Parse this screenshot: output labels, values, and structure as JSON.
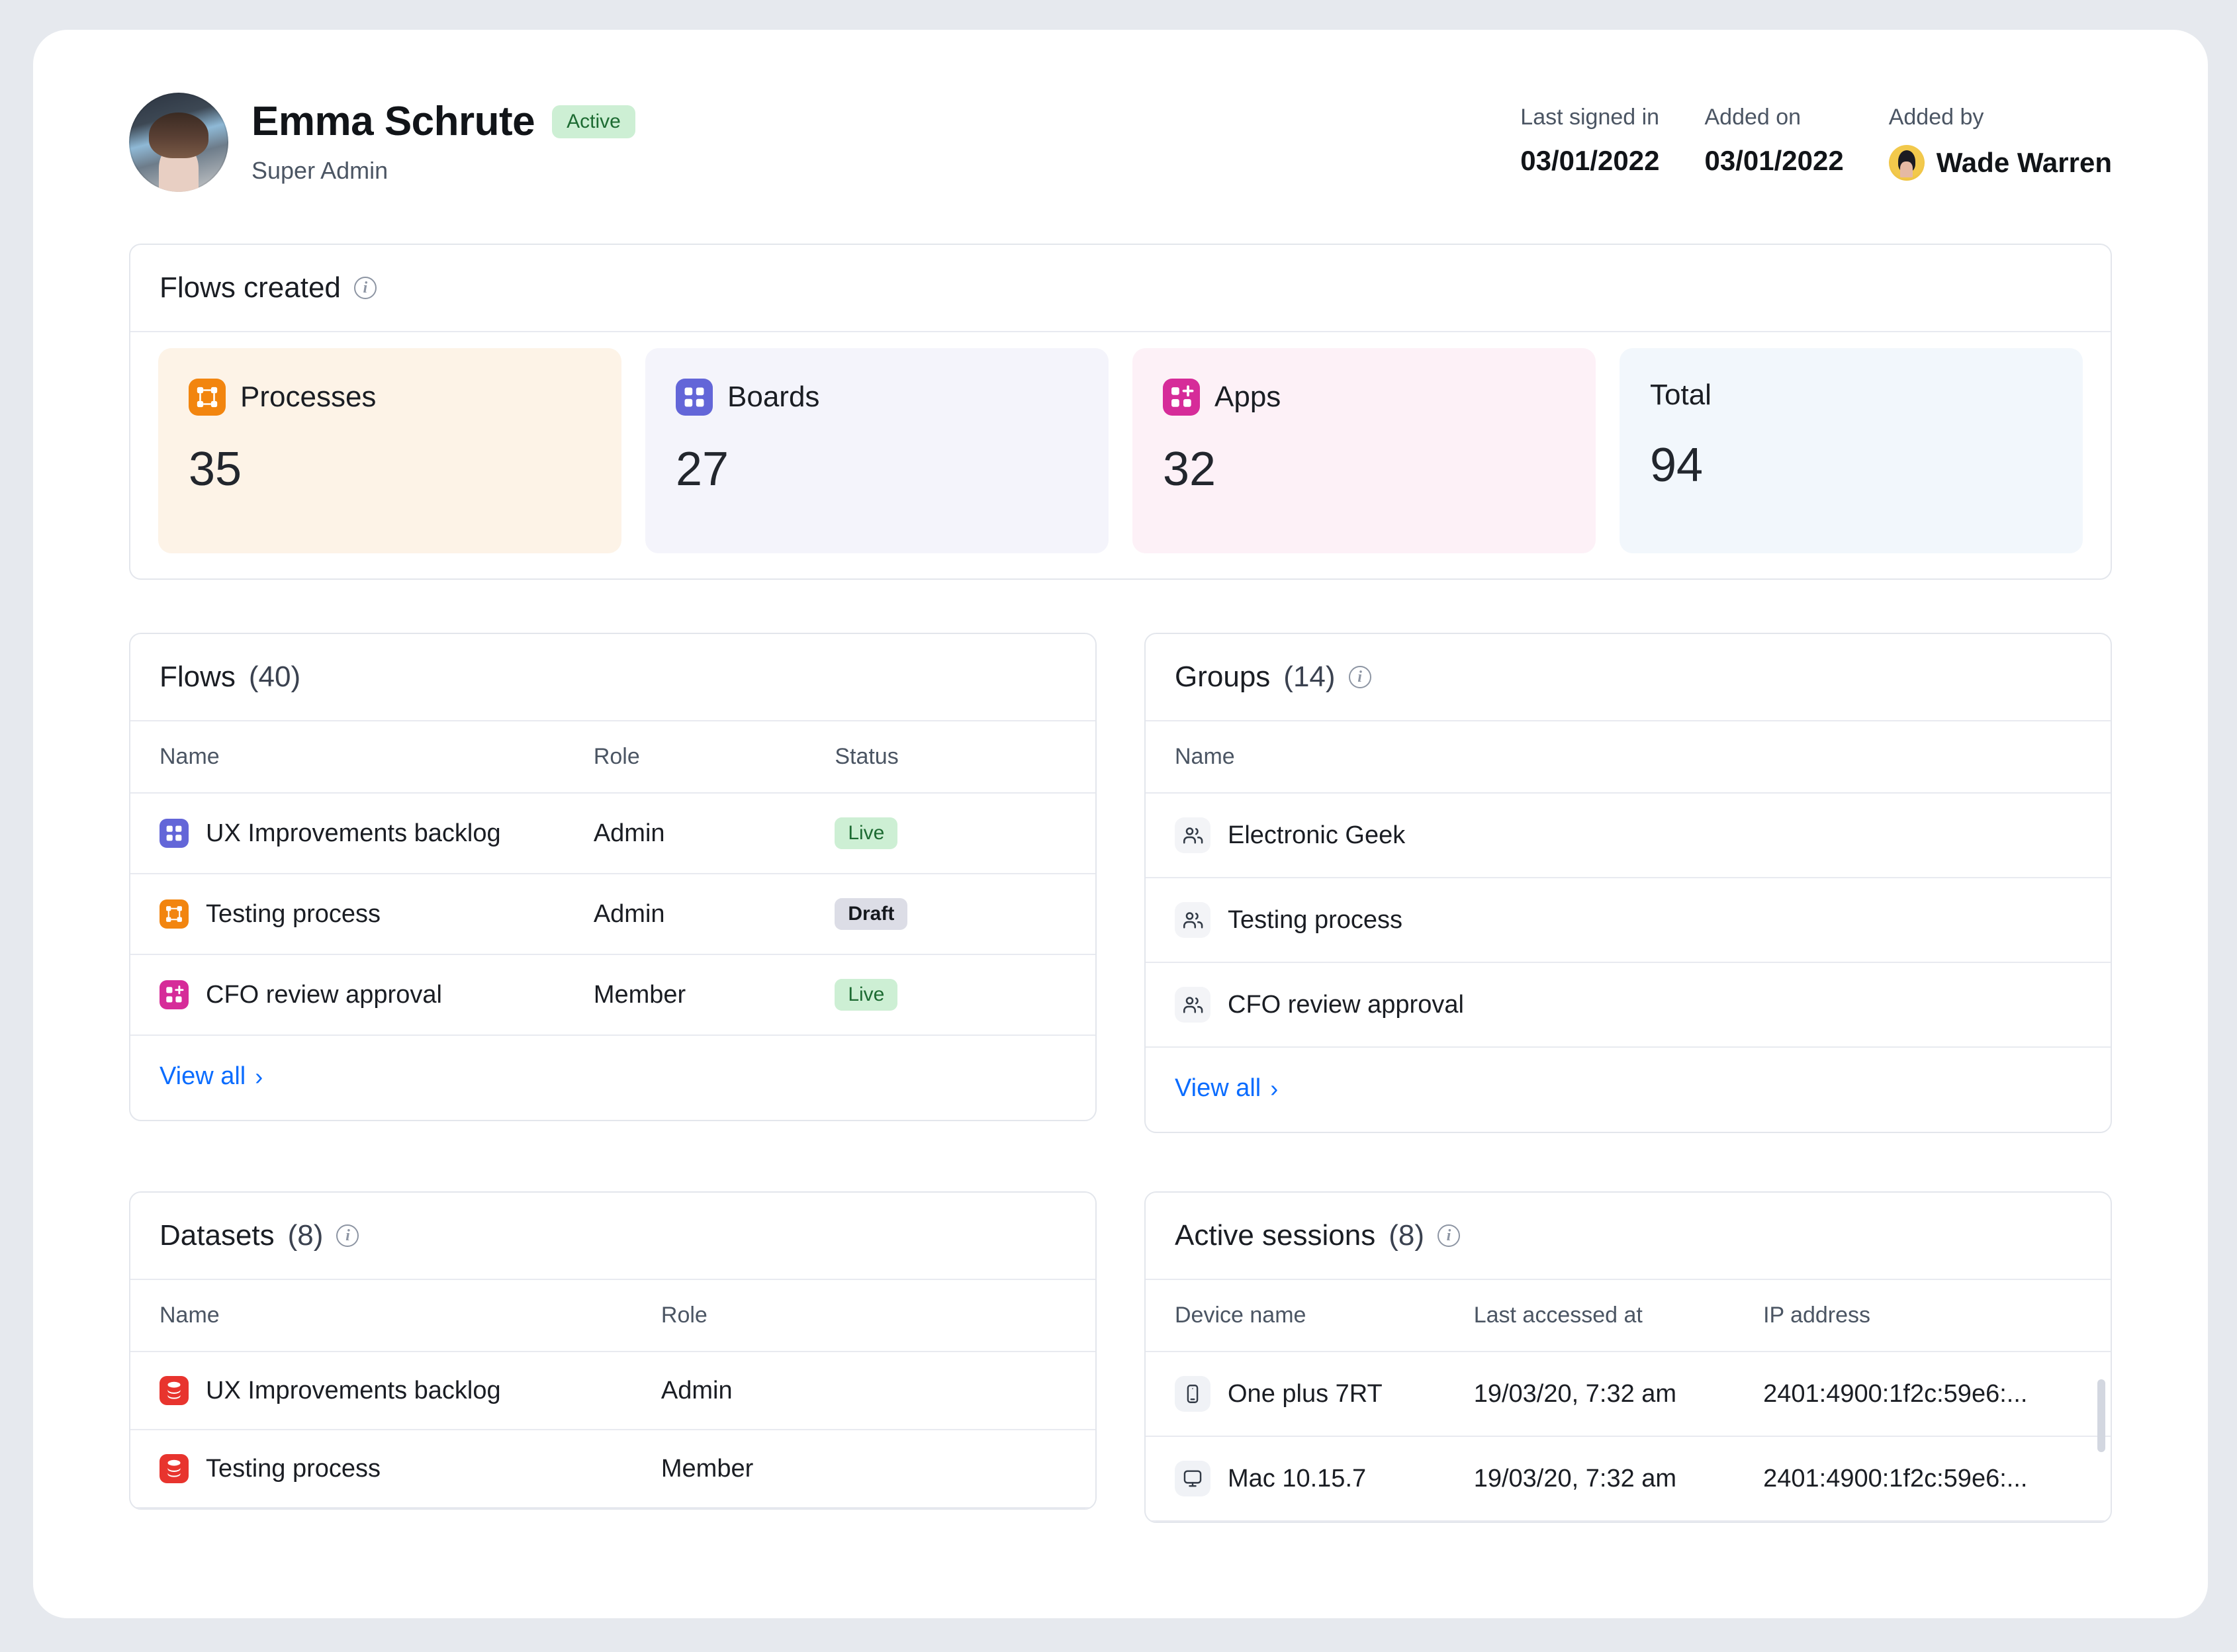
{
  "profile": {
    "name": "Emma Schrute",
    "status": "Active",
    "role": "Super Admin",
    "avatar_name": "emma-schrute-avatar",
    "meta": [
      {
        "label": "Last signed in",
        "value": "03/01/2022"
      },
      {
        "label": "Added on",
        "value": "03/01/2022"
      }
    ],
    "added_by_label": "Added by",
    "added_by_name": "Wade Warren"
  },
  "flows_created": {
    "title": "Flows created",
    "info_icon": "info-icon",
    "cards": [
      {
        "label": "Processes",
        "value": "35",
        "icon": "process-icon",
        "color": "#f2850f",
        "bg": "#fdf3e7"
      },
      {
        "label": "Boards",
        "value": "27",
        "icon": "board-icon",
        "color": "#6366d8",
        "bg": "#f4f4fb"
      },
      {
        "label": "Apps",
        "value": "32",
        "icon": "app-icon",
        "color": "#d62c99",
        "bg": "#fdf1f7"
      },
      {
        "label": "Total",
        "value": "94",
        "icon": "none",
        "color": "#22262d",
        "bg": "#f2f7fc"
      }
    ]
  },
  "flows": {
    "title": "Flows",
    "count": "(40)",
    "columns": [
      "Name",
      "Role",
      "Status"
    ],
    "rows": [
      {
        "icon": "board-icon",
        "name": "UX Improvements backlog",
        "role": "Admin",
        "status": "Live",
        "status_kind": "live"
      },
      {
        "icon": "process-icon",
        "name": "Testing process",
        "role": "Admin",
        "status": "Draft",
        "status_kind": "draft"
      },
      {
        "icon": "app-icon",
        "name": "CFO review approval",
        "role": "Member",
        "status": "Live",
        "status_kind": "live"
      }
    ],
    "view_all": "View all"
  },
  "groups": {
    "title": "Groups",
    "count": "(14)",
    "info_icon": "info-icon",
    "columns": [
      "Name"
    ],
    "rows": [
      {
        "icon": "users-icon",
        "name": "Electronic Geek"
      },
      {
        "icon": "users-icon",
        "name": "Testing process"
      },
      {
        "icon": "users-icon",
        "name": "CFO review approval"
      }
    ],
    "view_all": "View all"
  },
  "datasets": {
    "title": "Datasets",
    "count": "(8)",
    "info_icon": "info-icon",
    "columns": [
      "Name",
      "Role"
    ],
    "rows": [
      {
        "icon": "dataset-icon",
        "name": "UX Improvements backlog",
        "role": "Admin"
      },
      {
        "icon": "dataset-icon",
        "name": "Testing process",
        "role": "Member"
      }
    ]
  },
  "active_sessions": {
    "title": "Active sessions",
    "count": "(8)",
    "info_icon": "info-icon",
    "columns": [
      "Device name",
      "Last accessed at",
      "IP address"
    ],
    "rows": [
      {
        "icon": "phone-icon",
        "device": "One plus 7RT",
        "last_accessed": "19/03/20, 7:32 am",
        "ip": "2401:4900:1f2c:59e6:..."
      },
      {
        "icon": "monitor-icon",
        "device": "Mac 10.15.7",
        "last_accessed": "19/03/20, 7:32 am",
        "ip": "2401:4900:1f2c:59e6:..."
      }
    ]
  },
  "colors": {
    "accent_link": "#0a6cff",
    "live_bg": "#cdefd4",
    "live_text": "#1d6b32",
    "draft_bg": "#dcdde6",
    "page_bg": "#e6e9ee"
  }
}
